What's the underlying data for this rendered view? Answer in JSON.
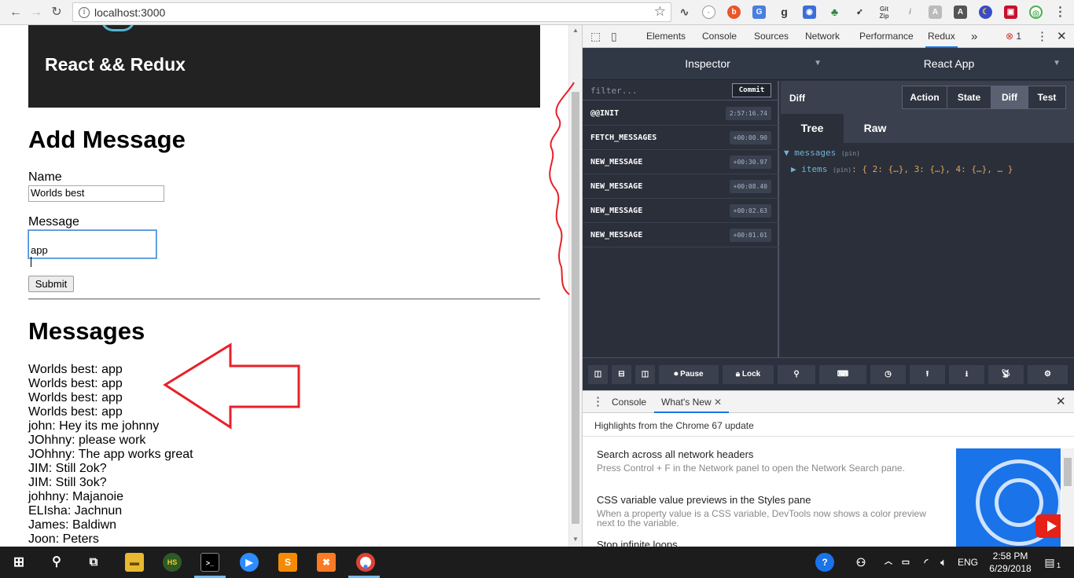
{
  "browser": {
    "url": "localhost:3000",
    "back_icon": "arrow-left",
    "forward_icon": "arrow-right",
    "reload_icon": "reload"
  },
  "page": {
    "header_title": "React && Redux",
    "add_heading": "Add Message",
    "name_label": "Name",
    "name_value": "Worlds best",
    "message_label": "Message",
    "message_value": "app",
    "submit_label": "Submit",
    "messages_heading": "Messages",
    "messages": [
      "Worlds best: app",
      "Worlds best: app",
      "Worlds best: app",
      "Worlds best: app",
      "john: Hey its me johnny",
      "JOhhny: please work",
      "JOhhny: The app works great",
      "JIM: Still 2ok?",
      "JIM: Still 3ok?",
      "johhny: Majanoie",
      "ELIsha: Jachnun",
      "James: Baldiwn",
      "Joon: Peters"
    ]
  },
  "devtools": {
    "tabs": [
      "Elements",
      "Console",
      "Sources",
      "Network",
      "Performance",
      "Redux"
    ],
    "active_tab": "Redux",
    "more_tabs": "»",
    "error_count": "1",
    "redux": {
      "inspector_label": "Inspector",
      "app_label": "React App",
      "filter_placeholder": "filter...",
      "commit_label": "Commit",
      "actions": [
        {
          "name": "@@INIT",
          "time": "2:57:16.74"
        },
        {
          "name": "FETCH_MESSAGES",
          "time": "+00:00.90"
        },
        {
          "name": "NEW_MESSAGE",
          "time": "+00:30.97"
        },
        {
          "name": "NEW_MESSAGE",
          "time": "+00:08.40"
        },
        {
          "name": "NEW_MESSAGE",
          "time": "+00:02.63"
        },
        {
          "name": "NEW_MESSAGE",
          "time": "+00:01.01"
        }
      ],
      "pane_title": "Diff",
      "monitor_tabs": [
        "Action",
        "State",
        "Diff",
        "Test"
      ],
      "active_monitor": "Diff",
      "view_tabs": [
        "Tree",
        "Raw"
      ],
      "active_view": "Tree",
      "tree": {
        "root_key": "messages",
        "pin": "(pin)",
        "child_key": "items",
        "child_value": ": { 2: {…}, 3: {…}, 4: {…}, … }"
      },
      "footer": {
        "pause_label": "Pause",
        "lock_label": "Lock"
      }
    },
    "drawer": {
      "tabs": [
        "Console",
        "What's New"
      ],
      "active_tab": "What's New",
      "highlights": "Highlights from the Chrome 67 update",
      "items": [
        {
          "title": "Search across all network headers",
          "desc": "Press Control + F in the Network panel to open the Network Search pane."
        },
        {
          "title": "CSS variable value previews in the Styles pane",
          "desc": "When a property value is a CSS variable, DevTools now shows a color preview next to the variable."
        },
        {
          "title": "Stop infinite loops",
          "desc": ""
        }
      ]
    }
  },
  "taskbar": {
    "time": "2:58 PM",
    "date": "6/29/2018",
    "language": "ENG",
    "notification_count": "1"
  },
  "colors": {
    "header_bg": "#222222",
    "redux_bg": "#2b313e",
    "annotation_red": "#e8202a",
    "chrome_blue": "#1a73e8"
  }
}
